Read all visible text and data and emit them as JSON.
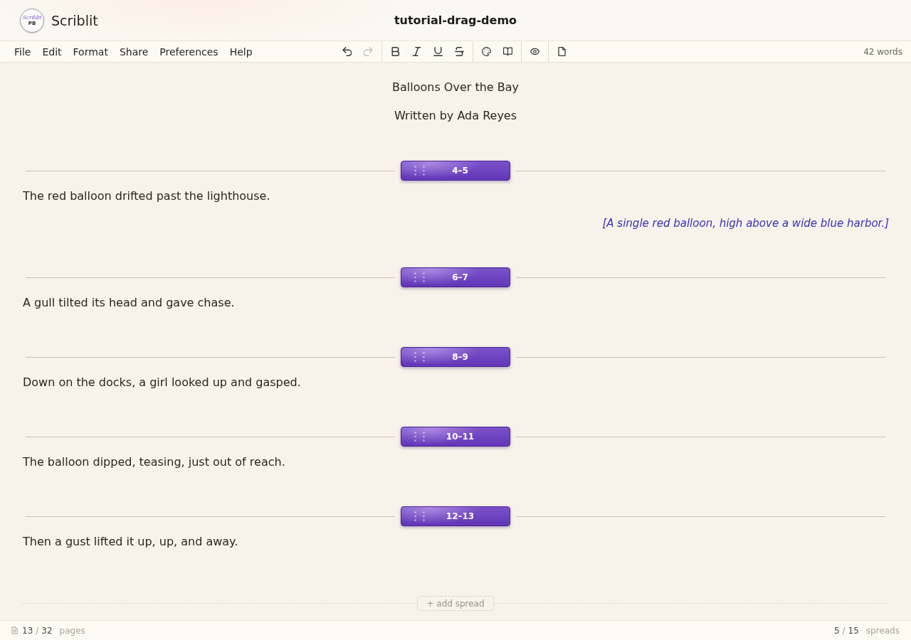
{
  "app": {
    "logo": {
      "script": "Scriblit",
      "initials": "PB"
    },
    "name": "Scriblit"
  },
  "document_title": "tutorial-drag-demo",
  "menu": [
    "File",
    "Edit",
    "Format",
    "Share",
    "Preferences",
    "Help"
  ],
  "toolbar": {
    "groups": [
      {
        "items": [
          {
            "kind": "undo",
            "disabled": false
          },
          {
            "kind": "redo",
            "disabled": true
          }
        ]
      },
      {
        "items": [
          {
            "kind": "bold",
            "disabled": false
          },
          {
            "kind": "italic",
            "disabled": false
          },
          {
            "kind": "underline",
            "disabled": false
          },
          {
            "kind": "strikethrough",
            "disabled": false
          }
        ]
      },
      {
        "items": [
          {
            "kind": "palette",
            "disabled": false
          },
          {
            "kind": "book",
            "disabled": false
          }
        ]
      },
      {
        "items": [
          {
            "kind": "eye",
            "disabled": false
          }
        ]
      },
      {
        "items": [
          {
            "kind": "page",
            "disabled": false
          }
        ]
      }
    ]
  },
  "word_count": "42 words",
  "book": {
    "title": "Balloons Over the Bay",
    "byline": "Written by Ada Reyes"
  },
  "spreads": [
    {
      "pages": "4–5",
      "text": "The red balloon drifted past the lighthouse.",
      "note": "[A single red balloon, high above a wide blue harbor.]"
    },
    {
      "pages": "6–7",
      "text": "A gull tilted its head and gave chase."
    },
    {
      "pages": "8–9",
      "text": "Down on the docks, a girl looked up and gasped."
    },
    {
      "pages": "10–11",
      "text": "The balloon dipped, teasing, just out of reach."
    },
    {
      "pages": "12–13",
      "text": "Then a gust lifted it up, up, and away."
    }
  ],
  "add_spread": "+ add spread",
  "status_bar": {
    "pages": {
      "current": "13",
      "separator": "/",
      "total": "32",
      "unit": "pages"
    },
    "spreads": {
      "current": "5",
      "separator": "/",
      "total": "15",
      "unit": "spreads"
    }
  }
}
